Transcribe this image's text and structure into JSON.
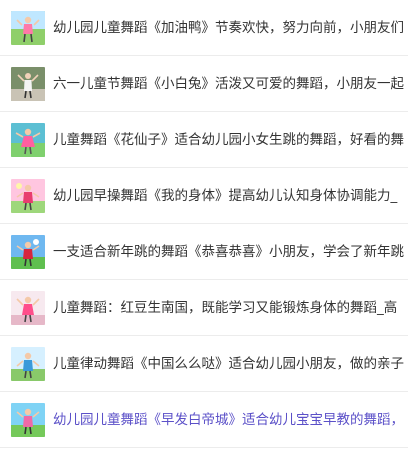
{
  "list": {
    "items": [
      {
        "title": "幼儿园儿童舞蹈《加油鸭》节奏欢快，努力向前，小朋友们",
        "thumb": "dancing-child-thumbnail",
        "color": "#333333"
      },
      {
        "title": "六一儿童节舞蹈《小白兔》活泼又可爱的舞蹈，小朋友一起",
        "thumb": "dancing-child-thumbnail",
        "color": "#333333"
      },
      {
        "title": "儿童舞蹈《花仙子》适合幼儿园小女生跳的舞蹈，好看的舞",
        "thumb": "dancing-child-thumbnail",
        "color": "#333333"
      },
      {
        "title": "幼儿园早操舞蹈《我的身体》提高幼儿认知身体协调能力_",
        "thumb": "dancing-child-thumbnail",
        "color": "#333333"
      },
      {
        "title": "一支适合新年跳的舞蹈《恭喜恭喜》小朋友，学会了新年跳",
        "thumb": "dancing-child-thumbnail",
        "color": "#333333"
      },
      {
        "title": "儿童舞蹈：红豆生南国，既能学习又能锻炼身体的舞蹈_高",
        "thumb": "dancing-child-thumbnail",
        "color": "#333333"
      },
      {
        "title": "儿童律动舞蹈《中国么么哒》适合幼儿园小朋友，做的亲子",
        "thumb": "dancing-child-thumbnail",
        "color": "#333333"
      },
      {
        "title": "幼儿园儿童舞蹈《早发白帝城》适合幼儿宝宝早教的舞蹈，",
        "thumb": "dancing-child-thumbnail",
        "color": "#5b50c8"
      }
    ]
  }
}
